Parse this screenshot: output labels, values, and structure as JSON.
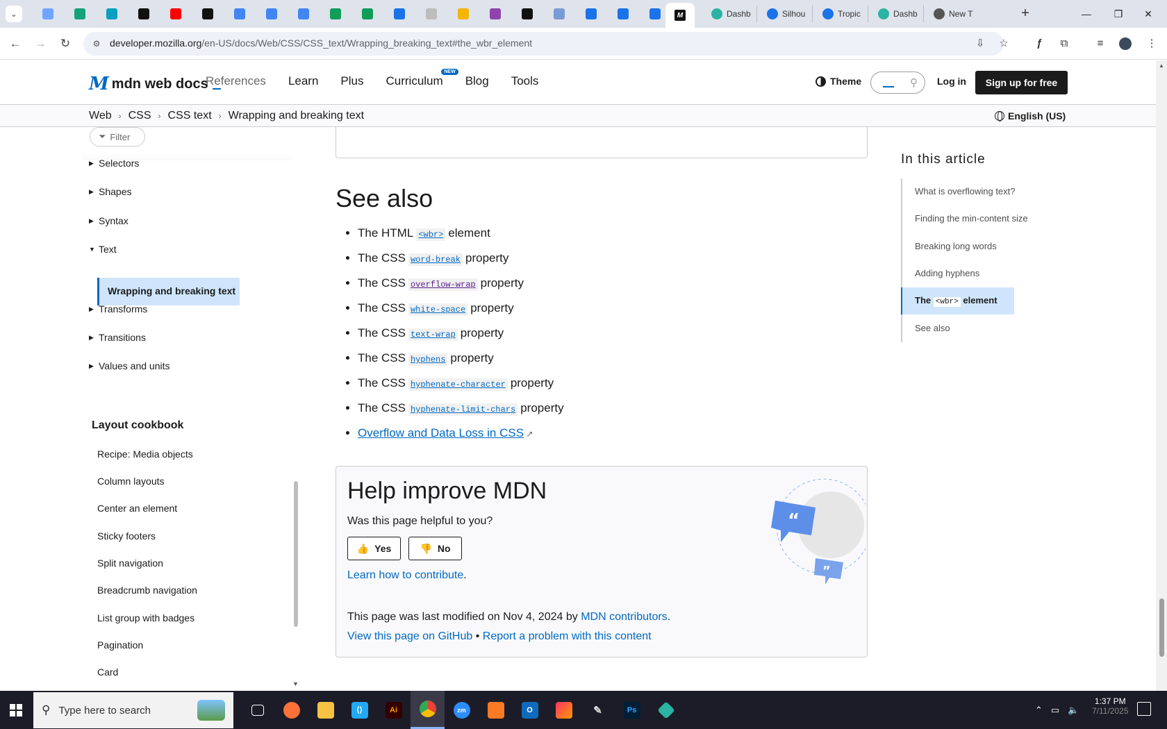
{
  "browser": {
    "tab_icons": [
      {
        "name": "tab-favicon-1",
        "color": "#6ea6ff"
      },
      {
        "name": "tab-favicon-2",
        "color": "#12a37a"
      },
      {
        "name": "tab-favicon-3",
        "color": "#0aa0c2"
      },
      {
        "name": "tab-favicon-4",
        "color": "#111111"
      },
      {
        "name": "tab-favicon-youtube",
        "color": "#ff0000"
      },
      {
        "name": "tab-favicon-6",
        "color": "#111111"
      },
      {
        "name": "tab-favicon-docs-1",
        "color": "#4285f4"
      },
      {
        "name": "tab-favicon-docs-2",
        "color": "#4285f4"
      },
      {
        "name": "tab-favicon-docs-3",
        "color": "#4285f4"
      },
      {
        "name": "tab-favicon-sheets-1",
        "color": "#0f9d58"
      },
      {
        "name": "tab-favicon-sheets-2",
        "color": "#0f9d58"
      },
      {
        "name": "tab-favicon-12",
        "color": "#1a73e8"
      },
      {
        "name": "tab-favicon-13",
        "color": "#bdbdbd"
      },
      {
        "name": "tab-favicon-14",
        "color": "#f4b400"
      },
      {
        "name": "tab-favicon-15",
        "color": "#8e44ad"
      },
      {
        "name": "tab-favicon-16",
        "color": "#111111"
      },
      {
        "name": "tab-favicon-17",
        "color": "#7a9bd6"
      },
      {
        "name": "tab-favicon-18",
        "color": "#1a73e8"
      },
      {
        "name": "tab-favicon-19",
        "color": "#1a73e8"
      },
      {
        "name": "tab-favicon-20",
        "color": "#1a73e8"
      }
    ],
    "named_tabs": [
      {
        "label": "Dashb",
        "color": "#2bb3a3"
      },
      {
        "label": "Silhou",
        "color": "#1a73e8"
      },
      {
        "label": "Tropic",
        "color": "#1a73e8"
      },
      {
        "label": "Dashb",
        "color": "#2bb3a3"
      },
      {
        "label": "New T",
        "color": "#555555"
      }
    ],
    "url_host": "developer.mozilla.org",
    "url_path": "/en-US/docs/Web/CSS/CSS_text/Wrapping_breaking_text#the_wbr_element"
  },
  "mdn": {
    "logo_text": "mdn web docs",
    "nav": [
      "References",
      "Learn",
      "Plus",
      "Curriculum",
      "Blog",
      "Tools"
    ],
    "new_badge": "NEW",
    "theme_label": "Theme",
    "login_label": "Log in",
    "signup_label": "Sign up for free",
    "breadcrumbs": [
      "Web",
      "CSS",
      "CSS text",
      "Wrapping and breaking text"
    ],
    "language": "English (US)"
  },
  "sidebar": {
    "filter_placeholder": "Filter",
    "items": [
      "Selectors",
      "Shapes",
      "Syntax",
      "Text"
    ],
    "active_item": "Wrapping and breaking text",
    "items_after": [
      "Transforms",
      "Transitions",
      "Values and units"
    ],
    "cookbook_heading": "Layout cookbook",
    "cookbook": [
      "Recipe: Media objects",
      "Column layouts",
      "Center an element",
      "Sticky footers",
      "Split navigation",
      "Breadcrumb navigation",
      "List group with badges",
      "Pagination",
      "Card"
    ]
  },
  "article": {
    "heading": "See also",
    "links": [
      {
        "pre": "The HTML",
        "code": "<wbr>",
        "post": "element"
      },
      {
        "pre": "The CSS",
        "code": "word-break",
        "post": "property"
      },
      {
        "pre": "The CSS",
        "code": "overflow-wrap",
        "post": "property"
      },
      {
        "pre": "The CSS",
        "code": "white-space",
        "post": "property"
      },
      {
        "pre": "The CSS",
        "code": "text-wrap",
        "post": "property"
      },
      {
        "pre": "The CSS",
        "code": "hyphens",
        "post": "property"
      },
      {
        "pre": "The CSS",
        "code": "hyphenate-character",
        "post": "property"
      },
      {
        "pre": "The CSS",
        "code": "hyphenate-limit-chars",
        "post": "property"
      }
    ],
    "external_link": "Overflow and Data Loss in CSS"
  },
  "help": {
    "title": "Help improve MDN",
    "question": "Was this page helpful to you?",
    "yes": "Yes",
    "no": "No",
    "learn": "Learn how to contribute",
    "modified_prefix": "This page was last modified on Nov 4, 2024 by",
    "contributors": "MDN contributors",
    "github": "View this page on GitHub",
    "report": "Report a problem with this content"
  },
  "toc": {
    "title": "In this article",
    "items": [
      "What is overflowing text?",
      "Finding the min-content size",
      "Breaking long words",
      "Adding hyphens"
    ],
    "active_pre": "The",
    "active_code": "<wbr>",
    "active_post": "element",
    "last": "See also"
  },
  "taskbar": {
    "search_placeholder": "Type here to search",
    "time": "1:37 PM",
    "date": "7/11/2025"
  }
}
